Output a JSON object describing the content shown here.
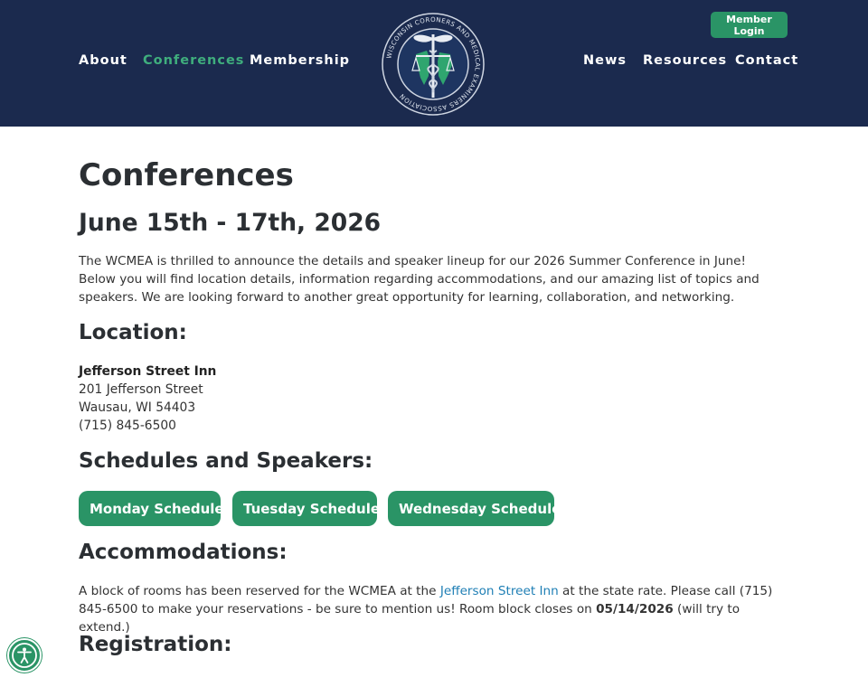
{
  "nav": {
    "left": [
      {
        "label": "About"
      },
      {
        "label": "Conferences"
      },
      {
        "label": "Membership"
      }
    ],
    "right": [
      {
        "label": "News"
      },
      {
        "label": "Resources"
      },
      {
        "label": "Contact"
      }
    ],
    "active": "Conferences",
    "member_login": "Member Login"
  },
  "logo": {
    "ring_text": "WISCONSIN CORONERS AND MEDICAL EXAMINERS ASSOCIATION"
  },
  "page": {
    "title": "Conferences",
    "date": "June 15th - 17th, 2026",
    "intro": "The WCMEA is thrilled to announce the details and speaker lineup for our 2026 Summer Conference in June! Below you will find location details, information regarding accommodations, and our amazing list of topics and speakers. We are looking forward to another great opportunity for learning, collaboration, and networking."
  },
  "location": {
    "heading": "Location:",
    "name": "Jefferson Street Inn",
    "street": "201 Jefferson Street",
    "city": "Wausau, WI 54403",
    "phone": "(715) 845-6500"
  },
  "schedules": {
    "heading": "Schedules and Speakers:",
    "buttons": [
      {
        "label": "Monday Schedule"
      },
      {
        "label": "Tuesday Schedule"
      },
      {
        "label": "Wednesday Schedule"
      }
    ]
  },
  "accommodations": {
    "heading": "Accommodations:",
    "text_1": "A block of rooms has been reserved for the WCMEA at the ",
    "link": "Jefferson Street Inn",
    "text_2": " at the state rate. Please call (715) 845-6500 to make your reservations - be sure to mention us! Room block closes on ",
    "close_date": "05/14/2026",
    "text_3": " (will try to extend.)"
  },
  "registration": {
    "heading": "Registration:"
  },
  "colors": {
    "header_bg": "#1b2a4e",
    "accent_green": "#2a9466",
    "active_nav": "#3fae7d",
    "link_blue": "#1f7fb5"
  }
}
